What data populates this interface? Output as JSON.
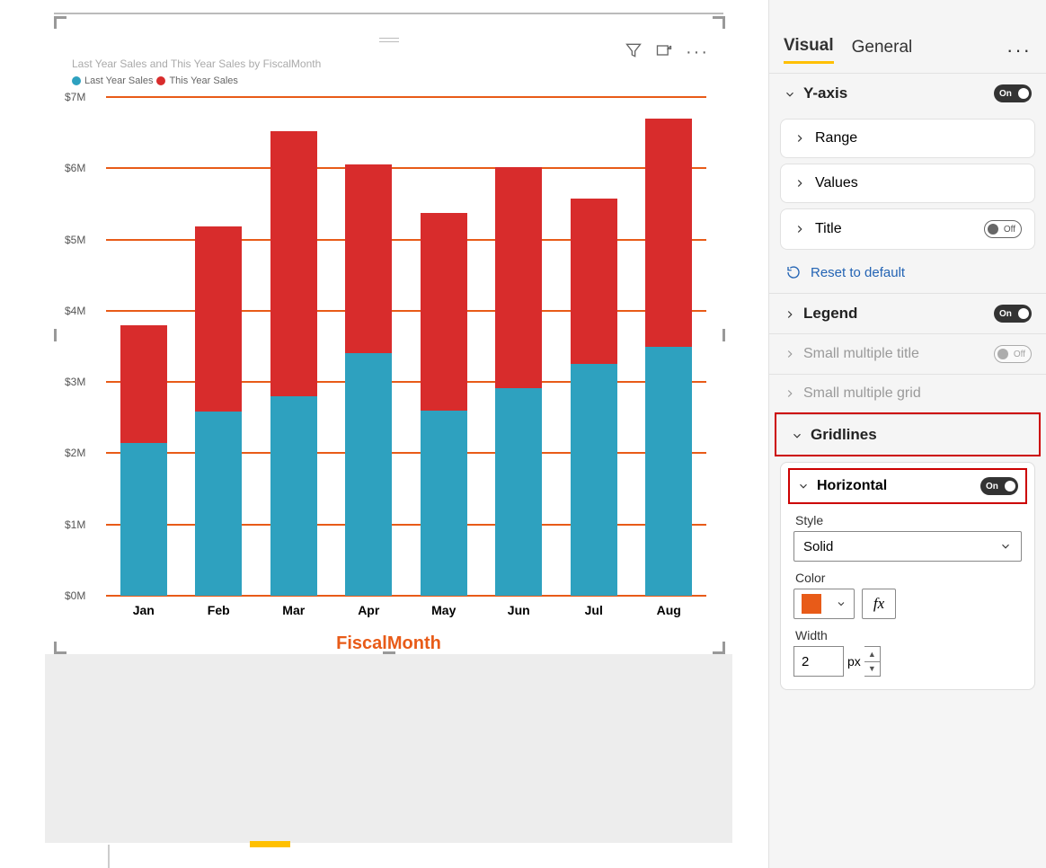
{
  "chart": {
    "title": "Last Year Sales and This Year Sales by FiscalMonth",
    "x_axis_title": "FiscalMonth",
    "x_axis_title_color": "#e85b18",
    "gridline_color": "#e85b18",
    "legend": [
      {
        "name": "Last Year Sales",
        "color": "#2ea1bf"
      },
      {
        "name": "This Year Sales",
        "color": "#d82c2c"
      }
    ],
    "y_ticks": [
      "$0M",
      "$1M",
      "$2M",
      "$3M",
      "$4M",
      "$5M",
      "$6M",
      "$7M"
    ],
    "y_max": 7
  },
  "chart_data": {
    "type": "bar",
    "stacked": true,
    "categories": [
      "Jan",
      "Feb",
      "Mar",
      "Apr",
      "May",
      "Jun",
      "Jul",
      "Aug"
    ],
    "series": [
      {
        "name": "Last Year Sales",
        "color": "#2ea1bf",
        "values": [
          2.15,
          2.58,
          2.8,
          3.4,
          2.6,
          2.92,
          3.25,
          3.5
        ]
      },
      {
        "name": "This Year Sales",
        "color": "#d82c2c",
        "values": [
          1.65,
          2.6,
          3.72,
          2.65,
          2.77,
          3.1,
          2.33,
          3.2
        ]
      }
    ],
    "title": "Last Year Sales and This Year Sales by FiscalMonth",
    "xlabel": "FiscalMonth",
    "ylabel": "",
    "ylim": [
      0,
      7
    ],
    "y_unit": "$M"
  },
  "pane": {
    "tabs": {
      "visual": "Visual",
      "general": "General"
    },
    "yaxis": {
      "label": "Y-axis",
      "toggle": "On"
    },
    "cards": {
      "range": "Range",
      "values": "Values",
      "title": {
        "label": "Title",
        "toggle": "Off"
      }
    },
    "reset": "Reset to default",
    "legend": {
      "label": "Legend",
      "toggle": "On"
    },
    "smt": {
      "label": "Small multiple title",
      "toggle": "Off"
    },
    "smg": {
      "label": "Small multiple grid"
    },
    "gridlines": {
      "label": "Gridlines"
    },
    "horizontal": {
      "label": "Horizontal",
      "toggle": "On"
    },
    "style": {
      "label": "Style",
      "value": "Solid"
    },
    "color": {
      "label": "Color",
      "value": "#e85b18"
    },
    "width": {
      "label": "Width",
      "value": "2",
      "unit": "px"
    },
    "fx": "fx"
  }
}
